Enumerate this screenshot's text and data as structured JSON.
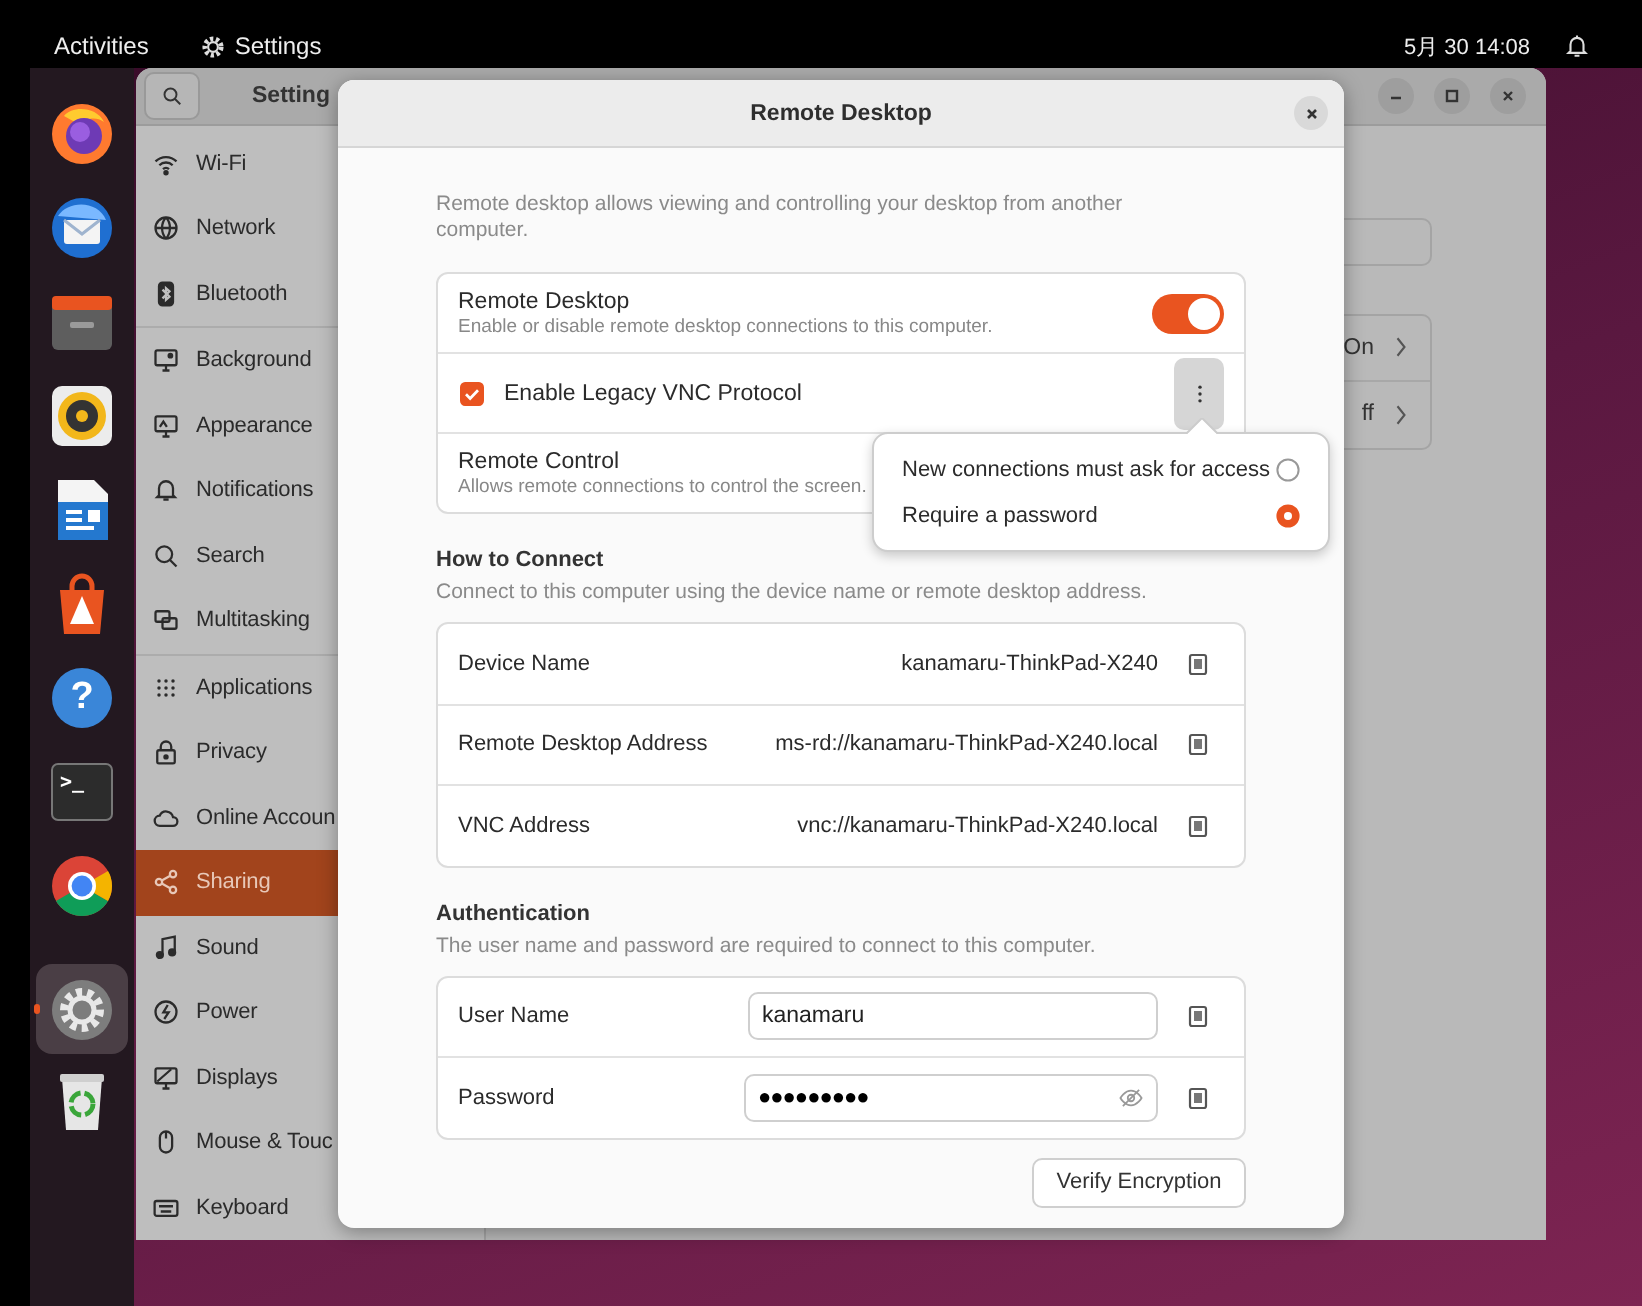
{
  "top_bar": {
    "activities": "Activities",
    "app_name": "Settings",
    "clock": "5月 30  14:08"
  },
  "dock": {
    "items": [
      {
        "kind": "firefox",
        "active": false
      },
      {
        "kind": "mail",
        "active": false
      },
      {
        "kind": "files",
        "active": false
      },
      {
        "kind": "music",
        "active": false
      },
      {
        "kind": "writer",
        "active": false
      },
      {
        "kind": "store",
        "active": false
      },
      {
        "kind": "help",
        "active": false,
        "glyph": "?"
      },
      {
        "kind": "terminal",
        "active": false,
        "glyph": ">_"
      },
      {
        "kind": "chrome",
        "active": false
      },
      {
        "kind": "settings",
        "active": true
      },
      {
        "kind": "trash",
        "active": false
      }
    ]
  },
  "settings_window": {
    "title": "Setting",
    "sidebar": {
      "groups": [
        {
          "items": [
            {
              "kind": "wifi",
              "label": "Wi-Fi",
              "selected": false
            },
            {
              "kind": "network",
              "label": "Network",
              "selected": false
            },
            {
              "kind": "bluetooth",
              "label": "Bluetooth",
              "selected": false
            }
          ]
        },
        {
          "items": [
            {
              "kind": "background",
              "label": "Background",
              "selected": false
            },
            {
              "kind": "appearance",
              "label": "Appearance",
              "selected": false
            },
            {
              "kind": "notifications",
              "label": "Notifications",
              "selected": false
            },
            {
              "kind": "search",
              "label": "Search",
              "selected": false
            },
            {
              "kind": "multitasking",
              "label": "Multitasking",
              "selected": false
            }
          ]
        },
        {
          "items": [
            {
              "kind": "applications",
              "label": "Applications",
              "selected": false
            },
            {
              "kind": "privacy",
              "label": "Privacy",
              "selected": false
            },
            {
              "kind": "online",
              "label": "Online Accoun",
              "selected": false
            },
            {
              "kind": "sharing",
              "label": "Sharing",
              "selected": true
            },
            {
              "kind": "sound",
              "label": "Sound",
              "selected": false
            },
            {
              "kind": "power",
              "label": "Power",
              "selected": false
            },
            {
              "kind": "displays",
              "label": "Displays",
              "selected": false
            },
            {
              "kind": "mouse",
              "label": "Mouse & Touc",
              "selected": false
            },
            {
              "kind": "keyboard",
              "label": "Keyboard",
              "selected": false
            }
          ]
        }
      ]
    },
    "pane_rows": [
      {
        "value": "On"
      },
      {
        "value": "ff"
      }
    ]
  },
  "dialog": {
    "title": "Remote Desktop",
    "description": "Remote desktop allows viewing and controlling your desktop from another computer.",
    "options": [
      {
        "kind": "switch",
        "title": "Remote Desktop",
        "subtitle": "Enable or disable remote desktop connections to this computer.",
        "on": true
      },
      {
        "kind": "checkbox",
        "title": "Enable Legacy VNC Protocol",
        "checked": true,
        "menu_open": true
      },
      {
        "kind": "plain",
        "title": "Remote Control",
        "subtitle": "Allows remote connections to control the screen."
      }
    ],
    "popover": {
      "options": [
        {
          "label": "New connections must ask for access",
          "selected": false
        },
        {
          "label": "Require a password",
          "selected": true
        }
      ]
    },
    "connect": {
      "heading": "How to Connect",
      "subtitle": "Connect to this computer using the device name or remote desktop address.",
      "rows": [
        {
          "label": "Device Name",
          "value": "kanamaru-ThinkPad-X240"
        },
        {
          "label": "Remote Desktop Address",
          "value": "ms-rd://kanamaru-ThinkPad-X240.local"
        },
        {
          "label": "VNC Address",
          "value": "vnc://kanamaru-ThinkPad-X240.local"
        }
      ]
    },
    "auth": {
      "heading": "Authentication",
      "subtitle": "The user name and password are required to connect to this computer.",
      "rows": [
        {
          "kind": "text",
          "label": "User Name",
          "value": "kanamaru"
        },
        {
          "kind": "password",
          "label": "Password",
          "value": "●●●●●●●●●"
        }
      ]
    },
    "button": "Verify Encryption"
  }
}
